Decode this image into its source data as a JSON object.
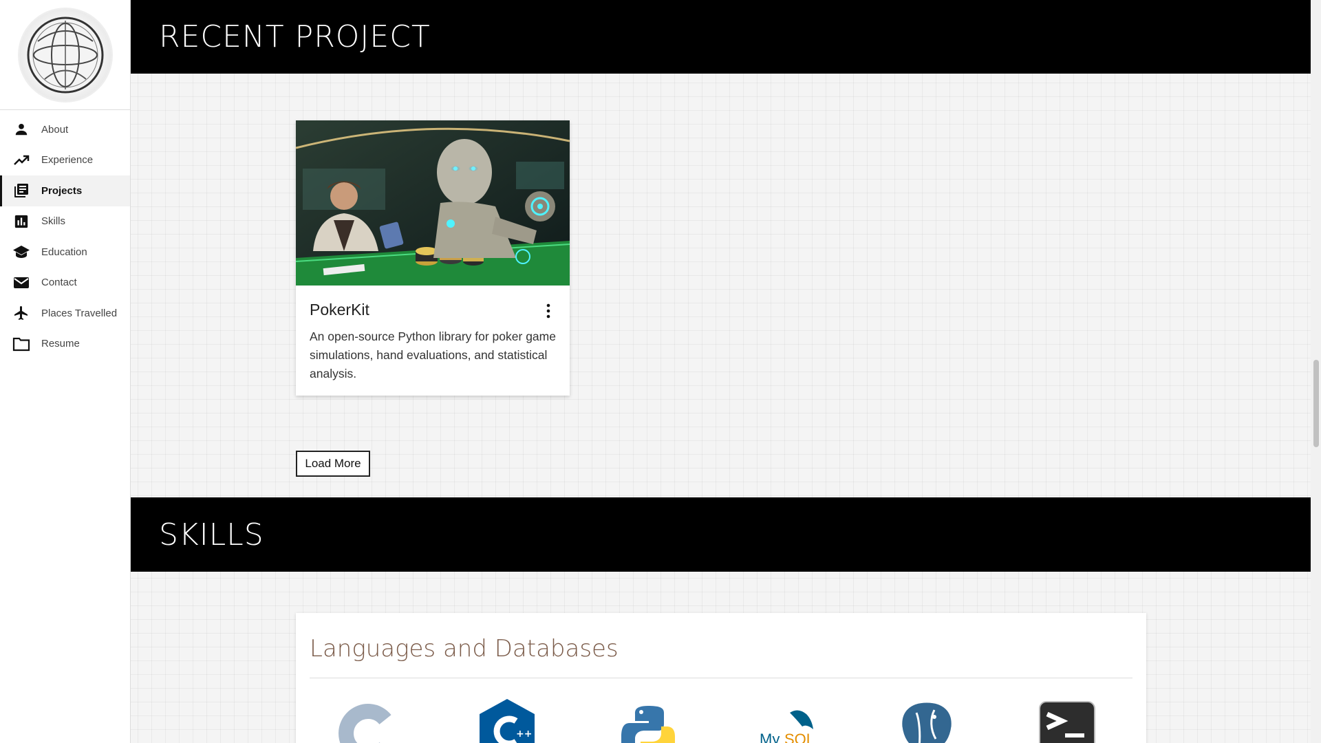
{
  "sidebar": {
    "items": [
      {
        "label": "About",
        "icon": "person-icon"
      },
      {
        "label": "Experience",
        "icon": "trending-up-icon"
      },
      {
        "label": "Projects",
        "icon": "library-books-icon",
        "active": true
      },
      {
        "label": "Skills",
        "icon": "bar-chart-icon"
      },
      {
        "label": "Education",
        "icon": "school-icon"
      },
      {
        "label": "Contact",
        "icon": "mail-icon"
      },
      {
        "label": "Places Travelled",
        "icon": "airplane-icon"
      },
      {
        "label": "Resume",
        "icon": "folder-icon"
      }
    ]
  },
  "projects": {
    "header": "RECENT PROJECT",
    "card": {
      "title": "PokerKit",
      "description": "An open-source Python library for poker game simulations, hand evaluations, and statistical analysis."
    },
    "load_more_label": "Load More"
  },
  "skills": {
    "header": "SKILLS",
    "category_title": "Languages and Databases",
    "icons": [
      "c-language-icon",
      "cpp-language-icon",
      "python-icon",
      "mysql-icon",
      "postgresql-icon",
      "terminal-icon"
    ]
  },
  "colors": {
    "header_bg": "#000000",
    "skills_title": "#7a5a48"
  }
}
